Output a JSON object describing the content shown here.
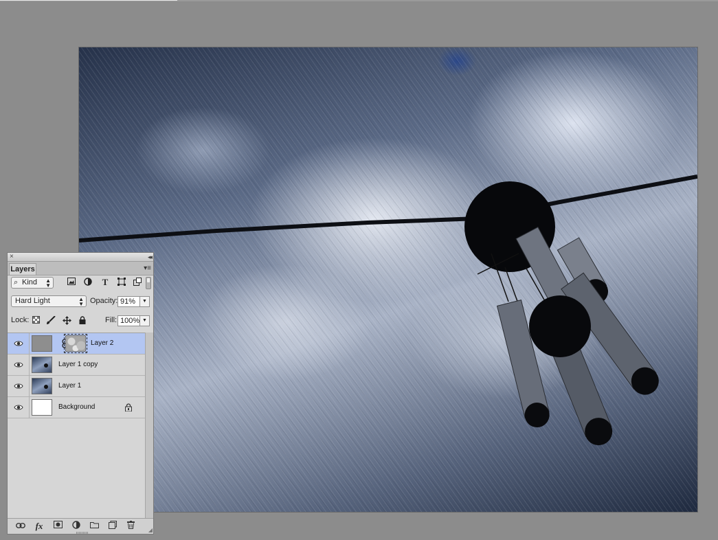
{
  "window": {
    "background": "#8c8c8c"
  },
  "panel": {
    "tab_label": "Layers",
    "close_glyph": "×",
    "collapse_glyph": "◂◂",
    "menu_glyph": "▾≡",
    "filter": {
      "kind_label": "Kind",
      "icons": [
        "image-filter-icon",
        "adjustment-filter-icon",
        "type-filter-icon",
        "shape-filter-icon",
        "smart-object-filter-icon"
      ]
    },
    "blend_mode": "Hard Light",
    "opacity_label": "Opacity:",
    "opacity_value": "91%",
    "lock_label": "Lock:",
    "fill_label": "Fill:",
    "fill_value": "100%",
    "layers": [
      {
        "name": "Layer 2",
        "selected": true,
        "visible": true,
        "thumb": "gray",
        "has_mask": true,
        "locked": false
      },
      {
        "name": "Layer 1 copy",
        "selected": false,
        "visible": true,
        "thumb": "photo",
        "has_mask": false,
        "locked": false
      },
      {
        "name": "Layer 1",
        "selected": false,
        "visible": true,
        "thumb": "photo",
        "has_mask": false,
        "locked": false
      },
      {
        "name": "Background",
        "selected": false,
        "visible": true,
        "thumb": "white",
        "has_mask": false,
        "locked": true
      }
    ],
    "bottom_icons": [
      "link-layers-icon",
      "fx-icon",
      "add-mask-icon",
      "adjustment-layer-icon",
      "new-group-icon",
      "new-layer-icon",
      "delete-layer-icon"
    ]
  },
  "colors": {
    "selected_row": "#b3c6f2",
    "panel_bg": "#d6d6d6"
  }
}
